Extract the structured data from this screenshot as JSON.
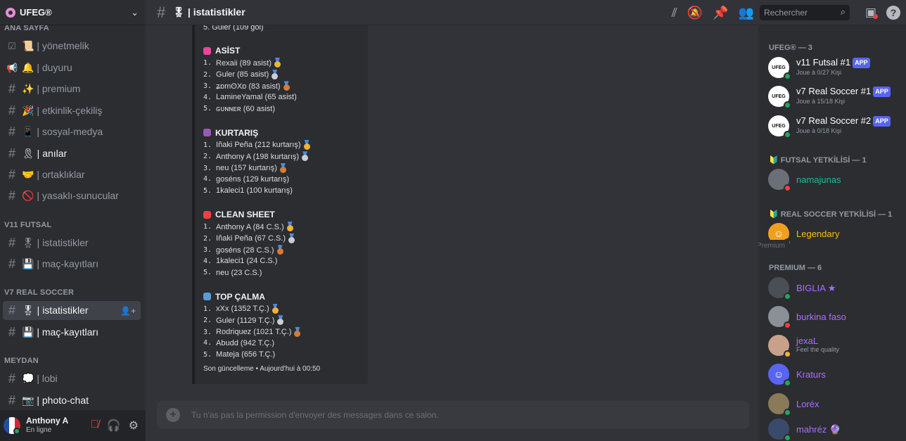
{
  "server": {
    "name": "UFEG®"
  },
  "channels": {
    "cat_main": "ANA SAYFA",
    "main": [
      {
        "emoji": "☑",
        "label": "📜 | yönetmelik",
        "hash": false
      },
      {
        "emoji": "📢",
        "label": "🔔 | duyuru",
        "hash": false
      },
      {
        "emoji": "#",
        "label": "✨ | premium",
        "hash": true
      },
      {
        "emoji": "#",
        "label": "🎉 | etkinlik-çekiliş",
        "hash": true
      },
      {
        "emoji": "#",
        "label": "📱 | sosyal-medya",
        "hash": true
      },
      {
        "emoji": "#",
        "label": "🎗 | anılar",
        "hash": true
      },
      {
        "emoji": "#",
        "label": "🤝 | ortaklıklar",
        "hash": true
      },
      {
        "emoji": "#",
        "label": "🚫 | yasaklı-sunucular",
        "hash": true
      }
    ],
    "cat_futsal": "V11 FUTSAL",
    "futsal": [
      {
        "label": "🎖 | istatistikler"
      },
      {
        "label": "💾 | maç-kayıtları"
      }
    ],
    "cat_real": "V7 REAL SOCCER",
    "real": [
      {
        "label": "🎖 | istatistikler"
      },
      {
        "label": "💾 | maç-kayıtları"
      }
    ],
    "cat_meydan": "MEYDAN",
    "meydan": [
      {
        "label": "💭 | lobi"
      },
      {
        "label": "📷 | photo-chat"
      }
    ]
  },
  "user": {
    "name": "Anthony A",
    "status": "En ligne"
  },
  "header": {
    "title": "🎖 | istatistikler",
    "search_placeholder": "Rechercher"
  },
  "embed": {
    "top_cut": "5. Guler (109 gol)",
    "sections": [
      {
        "title": "ASİST",
        "color": "#eb459e",
        "items": [
          "Rexaii (89 asist)",
          "Guler (85 asist)",
          "ʑɒmʘXɒ (83 asist)",
          "LamineYamal (65 asist)",
          "ɢᴜɴɴᴇʀ (60 asist)"
        ]
      },
      {
        "title": "KURTARIŞ",
        "color": "#9b59b6",
        "items": [
          "Iñaki Peña (212 kurtarış)",
          "Anthony A (198 kurtarış)",
          "neu (157 kurtarış)",
          "goséns (129 kurtarış)",
          "1kaleci1 (100 kurtarış)"
        ]
      },
      {
        "title": "CLEAN SHEET",
        "color": "#f23f43",
        "items": [
          "Anthony A (84 C.S.)",
          "Iñaki Peña (67 C.S.)",
          "goséns (28 C.S.)",
          "1kaleci1 (24 C.S.)",
          "neu (23 C.S.)"
        ]
      },
      {
        "title": "TOP ÇALMA",
        "color": "#5b9bd5",
        "items": [
          "xXx (1352 T.Ç.)",
          "Guler (1129 T.Ç.)",
          "Rodriquez (1021 T.Ç.)",
          "Abudd (942 T.Ç.)",
          "Mateja (656 T.Ç.)"
        ]
      }
    ],
    "footer": "Son güncelleme • Aujourd'hui à 00:50"
  },
  "composer": {
    "placeholder": "Tu n'as pas la permission d'envoyer des messages dans ce salon."
  },
  "members": {
    "cat_app": "UFEG® — 3",
    "apps": [
      {
        "name": "v11 Futsal #1",
        "badge": "APP",
        "sub": "Joue à 0/27 Kişi"
      },
      {
        "name": "v7 Real Soccer #1",
        "badge": "APP",
        "sub": "Joue à 15/18 Kişi"
      },
      {
        "name": "v7 Real Soccer #2",
        "badge": "APP",
        "sub": "Joue à 0/18 Kişi"
      }
    ],
    "cat_futsal": "🔰 FUTSAL YETKİLİSİ — 1",
    "futsal": {
      "name": "namajunas"
    },
    "cat_real": "🔰 REAL SOCCER YETKİLİSİ — 1",
    "real": {
      "name": "Legendary"
    },
    "tooltip": "Premium",
    "cat_premium": "PREMIUM — 6",
    "premium": [
      {
        "name": "BIGLIA ★",
        "sub": ""
      },
      {
        "name": "burkina faso",
        "sub": ""
      },
      {
        "name": "jexaL",
        "sub": "Feel the quality"
      },
      {
        "name": "Kraturs",
        "sub": ""
      },
      {
        "name": "Loréx",
        "sub": ""
      },
      {
        "name": "mahréz 🔮",
        "sub": ""
      }
    ],
    "avatar_label": "UFEG"
  },
  "colors": {
    "accent": "#5865f2",
    "online": "#23a55a",
    "dnd": "#f23f43",
    "idle": "#f0b232",
    "teal": "#1abc9c",
    "yellow": "#f1c40f",
    "purple": "#a970ff"
  }
}
